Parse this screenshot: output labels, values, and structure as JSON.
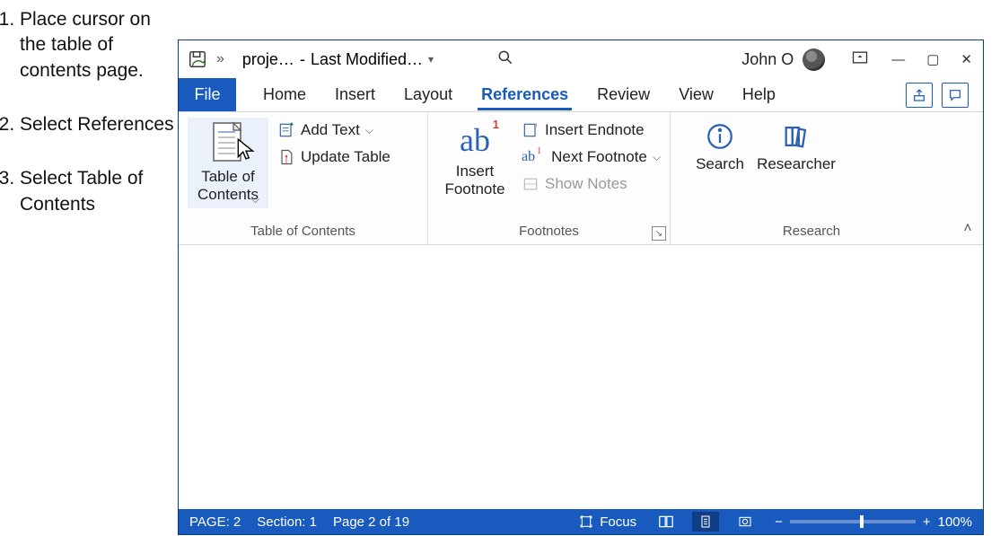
{
  "instructions": {
    "step1": "Place cursor on the table of contents page.",
    "step2": "Select References",
    "step3": "Select Table of Contents"
  },
  "titlebar": {
    "more": "»",
    "doc_name": "proje…",
    "sep": " - ",
    "modified": "Last Modified…",
    "user": "John O"
  },
  "tabs": {
    "file": "File",
    "home": "Home",
    "insert": "Insert",
    "layout": "Layout",
    "references": "References",
    "review": "Review",
    "view": "View",
    "help": "Help"
  },
  "ribbon": {
    "toc_group": {
      "button": "Table of\nContents",
      "add_text": "Add Text",
      "update_table": "Update Table",
      "label": "Table of Contents"
    },
    "footnotes_group": {
      "button": "Insert\nFootnote",
      "insert_endnote": "Insert Endnote",
      "next_footnote": "Next Footnote",
      "show_notes": "Show Notes",
      "label": "Footnotes"
    },
    "research_group": {
      "search": "Search",
      "researcher": "Researcher",
      "label": "Research"
    }
  },
  "statusbar": {
    "page": "PAGE: 2",
    "section": "Section: 1",
    "page_of": "Page 2 of 19",
    "focus": "Focus",
    "zoom": "100%"
  }
}
